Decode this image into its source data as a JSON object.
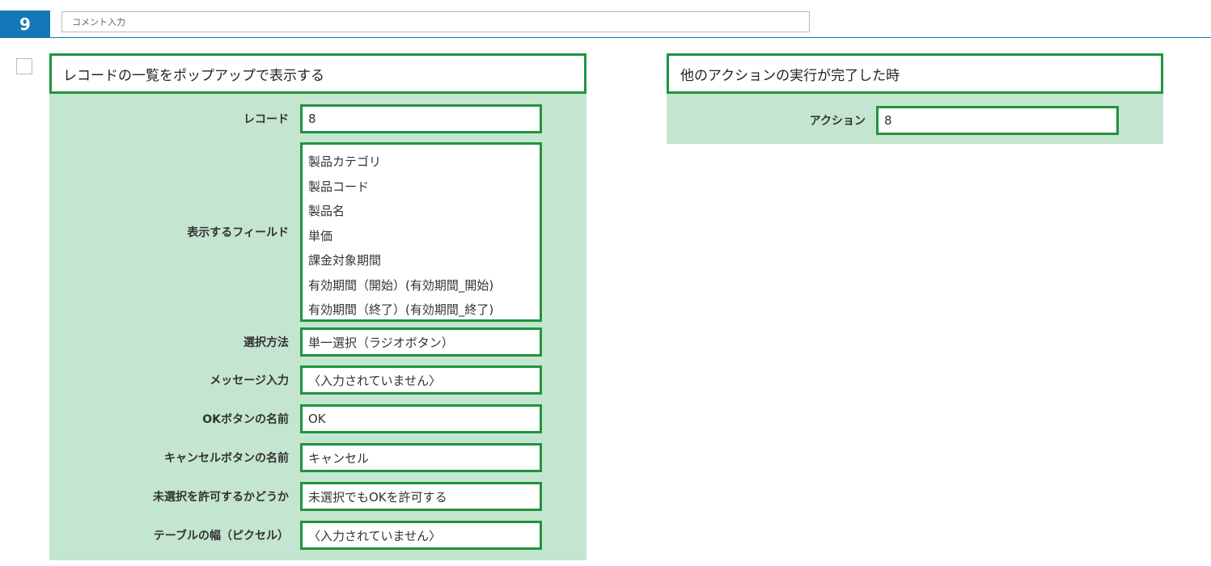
{
  "step": {
    "number": "9"
  },
  "comment": {
    "placeholder": "コメント入力"
  },
  "left_panel": {
    "title": "レコードの一覧をポップアップで表示する",
    "fields": [
      {
        "label": "レコード",
        "value": "8"
      },
      {
        "label": "表示するフィールド",
        "items": [
          "製品カテゴリ",
          "製品コード",
          "製品名",
          "単価",
          "課金対象期間",
          "有効期間（開始）(有効期間_開始)",
          "有効期間（終了）(有効期間_終了)"
        ]
      },
      {
        "label": "選択方法",
        "value": "単一選択（ラジオボタン）"
      },
      {
        "label": "メッセージ入力",
        "value": "〈入力されていません〉"
      },
      {
        "label": "OKボタンの名前",
        "value": "OK"
      },
      {
        "label": "キャンセルボタンの名前",
        "value": "キャンセル"
      },
      {
        "label": "未選択を許可するかどうか",
        "value": "未選択でもOKを許可する"
      },
      {
        "label": "テーブルの幅（ピクセル）",
        "value": "〈入力されていません〉"
      }
    ]
  },
  "right_panel": {
    "title": "他のアクションの実行が完了した時",
    "fields": [
      {
        "label": "アクション",
        "value": "8"
      }
    ]
  },
  "colors": {
    "accent_blue": "#1278b8",
    "border_green": "#21933f",
    "panel_green": "#c4e6d0"
  }
}
